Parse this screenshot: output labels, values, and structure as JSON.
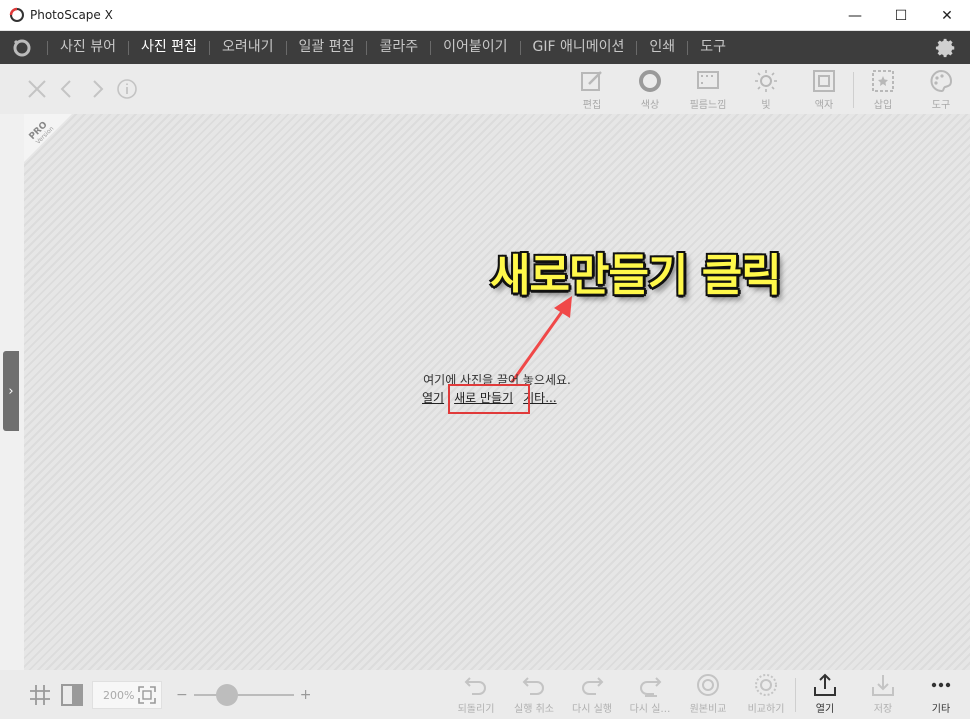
{
  "window": {
    "title": "PhotoScape X",
    "minimize_glyph": "—",
    "maximize_glyph": "☐",
    "close_glyph": "✕"
  },
  "menu": {
    "items": [
      {
        "label": "사진 뷰어",
        "active": false
      },
      {
        "label": "사진 편집",
        "active": true
      },
      {
        "label": "오려내기",
        "active": false
      },
      {
        "label": "일괄 편집",
        "active": false
      },
      {
        "label": "콜라주",
        "active": false
      },
      {
        "label": "이어붙이기",
        "active": false
      },
      {
        "label": "GIF 애니메이션",
        "active": false
      },
      {
        "label": "인쇄",
        "active": false
      },
      {
        "label": "도구",
        "active": false
      }
    ]
  },
  "toolbar": {
    "tools": [
      {
        "label": "편집",
        "icon": "edit-icon"
      },
      {
        "label": "색상",
        "icon": "color-icon"
      },
      {
        "label": "필름느낌",
        "icon": "film-icon"
      },
      {
        "label": "빛",
        "icon": "light-icon"
      },
      {
        "label": "액자",
        "icon": "frame-icon"
      },
      {
        "label": "삽입",
        "icon": "insert-icon"
      },
      {
        "label": "도구",
        "icon": "tools-palette-icon"
      }
    ]
  },
  "canvas": {
    "badge_main": "PRO",
    "badge_sub": "Version",
    "drop_text": "여기에 사진을 끌어 놓으세요.",
    "links": {
      "open": "열기",
      "new": "새로 만들기",
      "other": "기타..."
    },
    "annotation": "새로만들기 클릭",
    "handle_glyph": "›"
  },
  "bottom": {
    "zoom": "200%",
    "minus": "−",
    "plus": "+",
    "zoom_fraction": 0.33,
    "tools": [
      {
        "label": "되돌리기",
        "icon": "undo-icon"
      },
      {
        "label": "실행 취소",
        "icon": "undo-all-icon"
      },
      {
        "label": "다시 실행",
        "icon": "redo-icon"
      },
      {
        "label": "다시 실…",
        "icon": "redo-all-icon"
      },
      {
        "label": "원본비교",
        "icon": "compare-original-icon"
      },
      {
        "label": "비교하기",
        "icon": "compare-icon"
      }
    ],
    "actions": [
      {
        "label": "열기",
        "icon": "open-upload-icon"
      },
      {
        "label": "저장",
        "icon": "save-download-icon"
      },
      {
        "label": "기타",
        "icon": "more-icon"
      }
    ]
  },
  "colors": {
    "menubar_bg": "#3d3d3d",
    "highlight": "#e03a3a",
    "annotation_text": "#fff84a"
  }
}
